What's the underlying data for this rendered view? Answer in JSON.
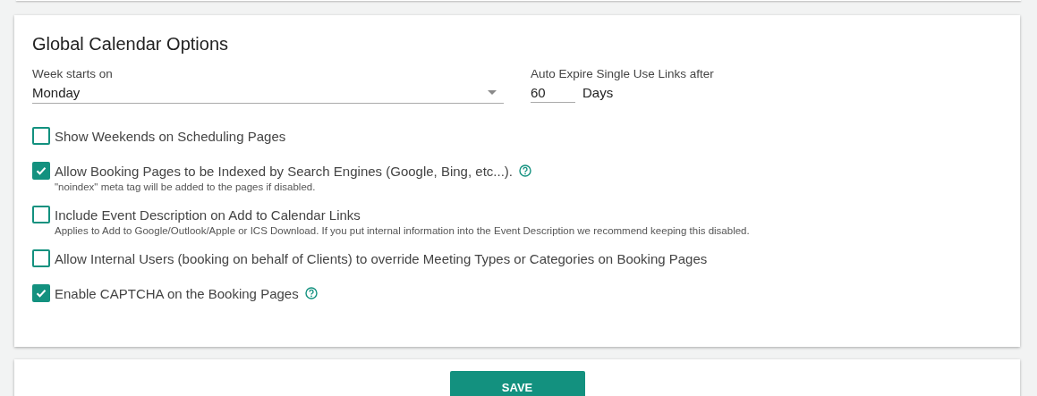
{
  "title": "Global Calendar Options",
  "week_start": {
    "label": "Week starts on",
    "value": "Monday"
  },
  "auto_expire": {
    "label": "Auto Expire Single Use Links after",
    "value": "60",
    "unit": "Days"
  },
  "options": [
    {
      "label": "Show Weekends on Scheduling Pages",
      "checked": false,
      "help": false
    },
    {
      "label": "Allow Booking Pages to be Indexed by Search Engines (Google, Bing, etc...).",
      "checked": true,
      "help": true,
      "note": "\"noindex\" meta tag will be added to the pages if disabled."
    },
    {
      "label": "Include Event Description on Add to Calendar Links",
      "checked": false,
      "help": false,
      "note": "Applies to Add to Google/Outlook/Apple or ICS Download. If you put internal information into the Event Description we recommend keeping this disabled."
    },
    {
      "label": "Allow Internal Users (booking on behalf of Clients) to override Meeting Types or Categories on Booking Pages",
      "checked": false,
      "help": false
    },
    {
      "label": "Enable CAPTCHA on the Booking Pages",
      "checked": true,
      "help": true
    }
  ],
  "save_button": "SAVE"
}
